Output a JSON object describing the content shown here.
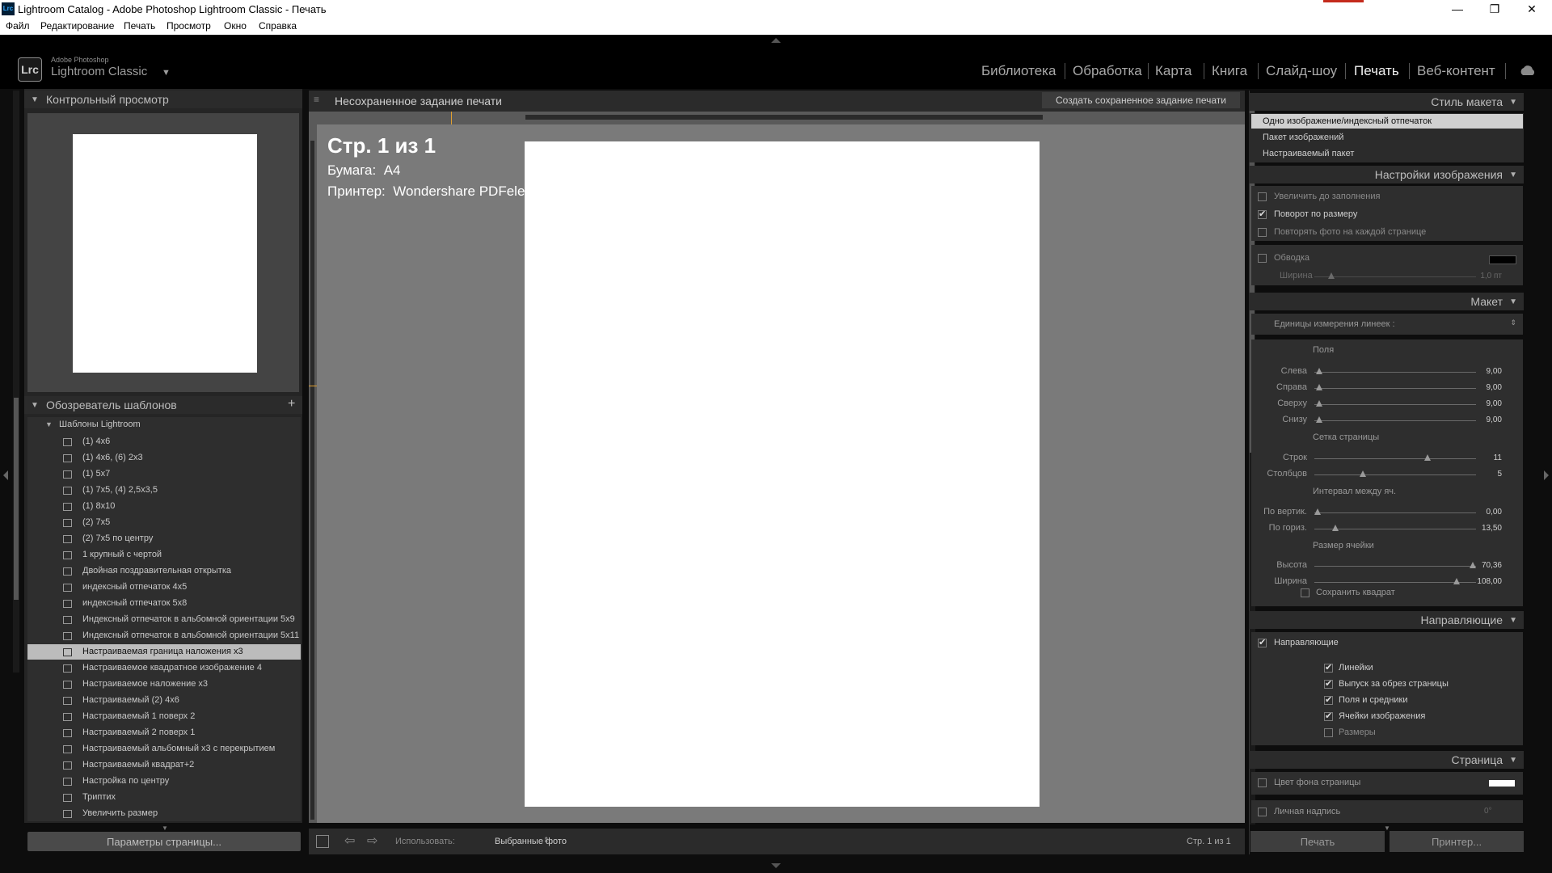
{
  "window": {
    "title": "Lightroom Catalog - Adobe Photoshop Lightroom Classic - Печать",
    "app_icon": "Lrc",
    "controls": [
      "—",
      "❐",
      "✕"
    ]
  },
  "menu": [
    "Файл",
    "Редактирование",
    "Печать",
    "Просмотр",
    "Окно",
    "Справка"
  ],
  "brand": {
    "logo": "Lrc",
    "line1": "Adobe Photoshop",
    "line2": "Lightroom Classic"
  },
  "modules": [
    {
      "label": "Библиотека",
      "active": false
    },
    {
      "label": "Обработка",
      "active": false
    },
    {
      "label": "Карта",
      "active": false
    },
    {
      "label": "Книга",
      "active": false
    },
    {
      "label": "Слайд-шоу",
      "active": false
    },
    {
      "label": "Печать",
      "active": true
    },
    {
      "label": "Веб-контент",
      "active": false
    }
  ],
  "left": {
    "preview_title": "Контрольный просмотр",
    "templates_title": "Обозреватель шаблонов",
    "add_icon": "+",
    "group": "Шаблоны Lightroom",
    "templates": [
      "(1) 4x6",
      "(1) 4x6, (6) 2x3",
      "(1) 5x7",
      "(1) 7x5, (4) 2,5x3,5",
      "(1) 8x10",
      "(2) 7x5",
      "(2) 7x5 по центру",
      "1 крупный с чертой",
      "Двойная поздравительная открытка",
      "индексный отпечаток 4x5",
      "индексный отпечаток 5x8",
      "Индексный отпечаток в альбомной ориентации 5x9",
      "Индексный отпечаток в альбомной ориентации 5x11",
      "Настраиваемая граница наложения x3",
      "Настраиваемое квадратное изображение 4",
      "Настраиваемое наложение x3",
      "Настраиваемый (2) 4x6",
      "Настраиваемый 1 поверх 2",
      "Настраиваемый 2 поверх 1",
      "Настраиваемый альбомный x3 с перекрытием",
      "Настраиваемый квадрат+2",
      "Настройка по центру",
      "Триптих",
      "Увеличить размер"
    ],
    "selected_index": 13,
    "page_setup_button": "Параметры страницы..."
  },
  "center": {
    "job_title": "Несохраненное задание печати",
    "save_button": "Создать сохраненное задание печати",
    "page_info": "Стр. 1 из 1",
    "paper_label": "Бумага:",
    "paper_value": "A4",
    "printer_label": "Принтер:",
    "printer_value": "Wondershare PDFelement",
    "use_label": "Использовать:",
    "use_value": "Выбранные фото",
    "page_counter": "Стр. 1 из 1"
  },
  "right": {
    "layout_style": {
      "title": "Стиль макета",
      "options": [
        "Одно изображение/индексный отпечаток",
        "Пакет изображений",
        "Настраиваемый пакет"
      ],
      "selected": 0
    },
    "image_settings": {
      "title": "Настройки изображения",
      "zoom_to_fill": {
        "label": "Увеличить до заполнения",
        "checked": false
      },
      "rotate_to_fit": {
        "label": "Поворот по размеру",
        "checked": true
      },
      "repeat_photo": {
        "label": "Повторять фото на каждой странице",
        "checked": false
      },
      "stroke": {
        "label": "Обводка",
        "checked": false
      },
      "stroke_width_label": "Ширина",
      "stroke_width_value": "1,0 пт",
      "stroke_color": "#000000"
    },
    "layout": {
      "title": "Макет",
      "ruler_units": "Единицы измерения линеек :",
      "margins_title": "Поля",
      "margins": [
        {
          "label": "Слева",
          "value": "9,00",
          "pos": 0.03
        },
        {
          "label": "Справа",
          "value": "9,00",
          "pos": 0.03
        },
        {
          "label": "Сверху",
          "value": "9,00",
          "pos": 0.03
        },
        {
          "label": "Снизу",
          "value": "9,00",
          "pos": 0.03
        }
      ],
      "grid_title": "Сетка страницы",
      "grid": [
        {
          "label": "Строк",
          "value": "11",
          "pos": 0.7
        },
        {
          "label": "Столбцов",
          "value": "5",
          "pos": 0.3
        }
      ],
      "spacing_title": "Интервал между яч.",
      "spacing": [
        {
          "label": "По вертик.",
          "value": "0,00",
          "pos": 0.02
        },
        {
          "label": "По гориз.",
          "value": "13,50",
          "pos": 0.13
        }
      ],
      "cell_title": "Размер ячейки",
      "cell": [
        {
          "label": "Высота",
          "value": "70,36",
          "pos": 0.98
        },
        {
          "label": "Ширина",
          "value": "108,00",
          "pos": 0.88
        }
      ],
      "keep_square": {
        "label": "Сохранить квадрат",
        "checked": false
      }
    },
    "guides": {
      "title": "Направляющие",
      "show": {
        "label": "Направляющие",
        "checked": true
      },
      "items": [
        {
          "label": "Линейки",
          "checked": true
        },
        {
          "label": "Выпуск за обрез страницы",
          "checked": true
        },
        {
          "label": "Поля и средники",
          "checked": true
        },
        {
          "label": "Ячейки изображения",
          "checked": true
        },
        {
          "label": "Размеры",
          "checked": false
        }
      ]
    },
    "page": {
      "title": "Страница",
      "bg_color": {
        "label": "Цвет фона страницы",
        "checked": false
      },
      "bg_swatch": "#ffffff",
      "identity_plate": {
        "label": "Личная надпись",
        "checked": false
      },
      "identity_angle": "0°"
    },
    "print_button": "Печать",
    "printer_button": "Принтер..."
  },
  "colors": {
    "bg": "#0d0d0d",
    "panel": "#2b2b2b",
    "canvas": "#7a7a7a",
    "paper": "#ffffff",
    "accent": "#e0a030"
  }
}
